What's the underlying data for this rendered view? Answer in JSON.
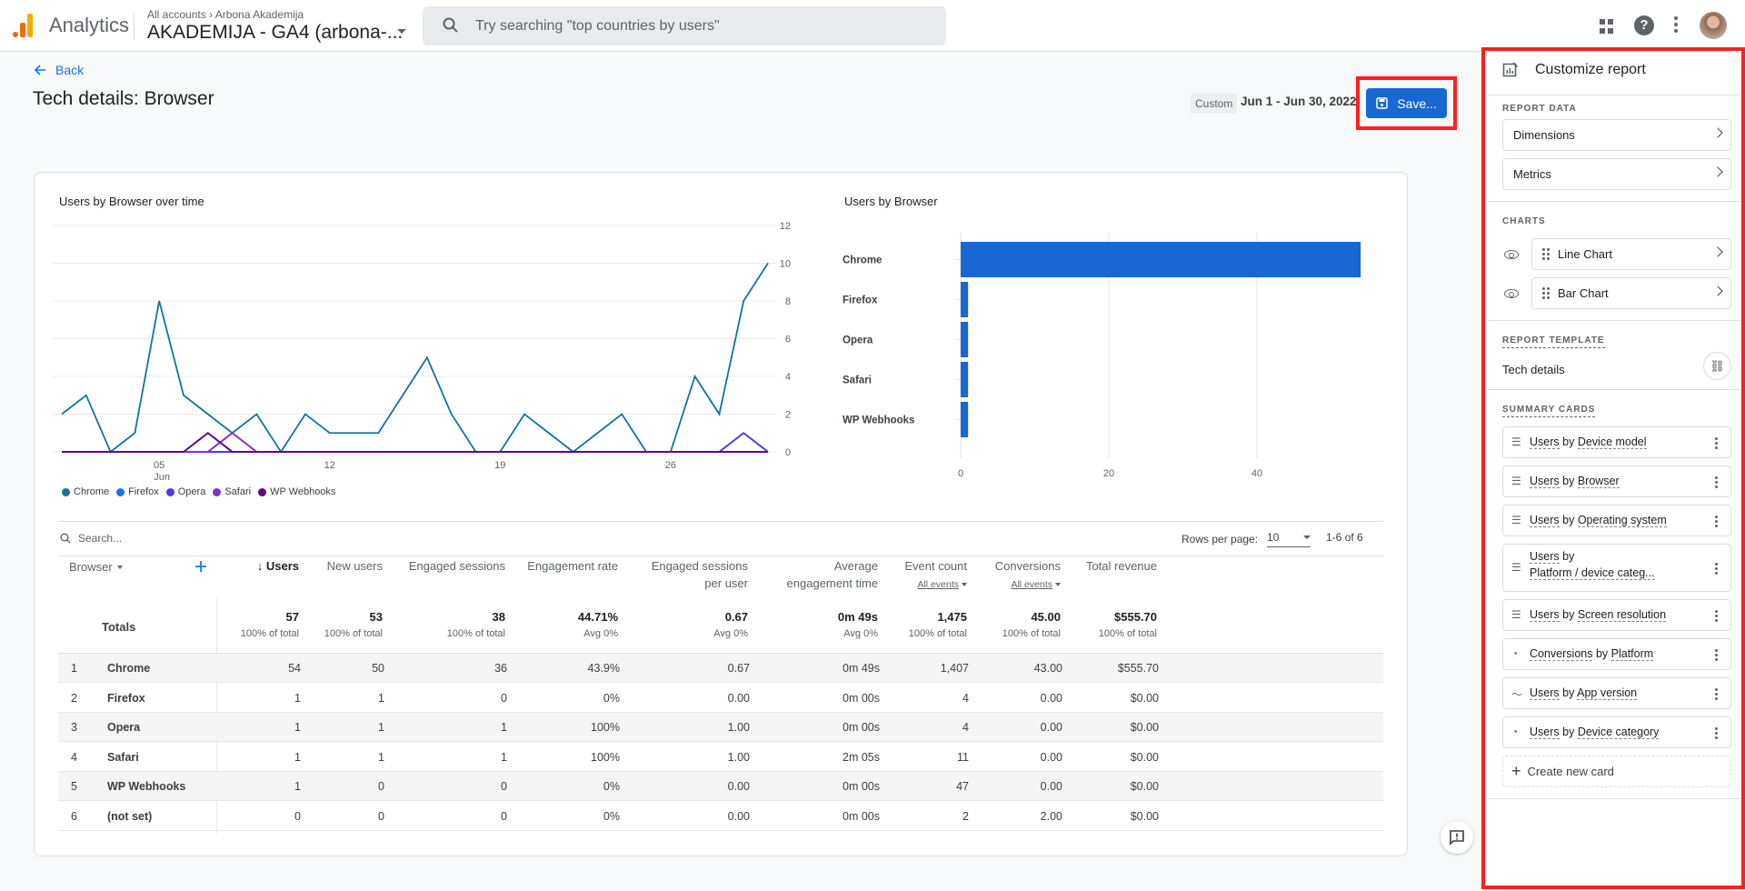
{
  "topbar": {
    "app_name": "Analytics",
    "breadcrumb": "All accounts › Arbona Akademija",
    "property": "AKADEMIJA - GA4 (arbona-...",
    "search_placeholder": "Try searching \"top countries by users\""
  },
  "header": {
    "back_label": "Back",
    "title": "Tech details: Browser",
    "date_chip": "Custom",
    "date_range": "Jun 1 - Jun 30, 2022",
    "save_label": "Save..."
  },
  "colors": {
    "accent": "#1a73e8",
    "save_button": "#1967d2",
    "highlight": "#ff1f1f",
    "bar": "#1967d2"
  },
  "chart_data": [
    {
      "type": "line",
      "title": "Users by Browser over time",
      "x": [
        1,
        2,
        3,
        4,
        5,
        6,
        7,
        8,
        9,
        10,
        11,
        12,
        13,
        14,
        15,
        16,
        17,
        18,
        19,
        20,
        21,
        22,
        23,
        24,
        25,
        26,
        27,
        28,
        29,
        30
      ],
      "x_ticks": [
        {
          "day": 5,
          "label": "05",
          "sublabel": "Jun"
        },
        {
          "day": 12,
          "label": "12",
          "sublabel": ""
        },
        {
          "day": 19,
          "label": "19",
          "sublabel": ""
        },
        {
          "day": 26,
          "label": "26",
          "sublabel": ""
        }
      ],
      "y_ticks": [
        0,
        2,
        4,
        6,
        8,
        10,
        12
      ],
      "ylim": [
        0,
        12
      ],
      "grid": true,
      "legend_position": "bottom-left",
      "series": [
        {
          "name": "Chrome",
          "color": "#12739f",
          "values": [
            2,
            3,
            0,
            1,
            8,
            3,
            2,
            1,
            2,
            0,
            2,
            1,
            1,
            1,
            3,
            5,
            2,
            0,
            0,
            2,
            1,
            0,
            1,
            2,
            0,
            0,
            4,
            2,
            8,
            10
          ]
        },
        {
          "name": "Firefox",
          "color": "#1a73e8",
          "values": [
            0,
            0,
            0,
            0,
            0,
            0,
            0,
            0,
            0,
            0,
            0,
            0,
            0,
            0,
            0,
            0,
            0,
            0,
            0,
            0,
            0,
            0,
            0,
            0,
            0,
            0,
            0,
            0,
            0,
            0
          ]
        },
        {
          "name": "Opera",
          "color": "#4b3ae6",
          "values": [
            0,
            0,
            0,
            0,
            0,
            0,
            0,
            0,
            0,
            0,
            0,
            0,
            0,
            0,
            0,
            0,
            0,
            0,
            0,
            0,
            0,
            0,
            0,
            0,
            0,
            0,
            0,
            0,
            1,
            0
          ]
        },
        {
          "name": "Safari",
          "color": "#7b36c9",
          "values": [
            0,
            0,
            0,
            0,
            0,
            0,
            0,
            1,
            0,
            0,
            0,
            0,
            0,
            0,
            0,
            0,
            0,
            0,
            0,
            0,
            0,
            0,
            0,
            0,
            0,
            0,
            0,
            0,
            0,
            0
          ]
        },
        {
          "name": "WP Webhooks",
          "color": "#5c0a85",
          "values": [
            0,
            0,
            0,
            0,
            0,
            0,
            1,
            0,
            0,
            0,
            0,
            0,
            0,
            0,
            0,
            0,
            0,
            0,
            0,
            0,
            0,
            0,
            0,
            0,
            0,
            0,
            0,
            0,
            0,
            0
          ]
        }
      ]
    },
    {
      "type": "bar",
      "orientation": "horizontal",
      "title": "Users by Browser",
      "categories": [
        "Chrome",
        "Firefox",
        "Opera",
        "Safari",
        "WP Webhooks"
      ],
      "values": [
        54,
        1,
        1,
        1,
        1
      ],
      "x_ticks": [
        0,
        20,
        40,
        60
      ],
      "xlim": [
        0,
        60
      ],
      "grid": true
    }
  ],
  "table": {
    "search_placeholder": "Search...",
    "rows_per_page_label": "Rows per page:",
    "rows_per_page": "10",
    "pager": "1-6 of 6",
    "dimension_header": "Browser",
    "columns": [
      {
        "label": "↓ Users",
        "line2": "",
        "sub": ""
      },
      {
        "label": "New users",
        "line2": "",
        "sub": ""
      },
      {
        "label": "Engaged sessions",
        "line2": "",
        "sub": ""
      },
      {
        "label": "Engagement rate",
        "line2": "",
        "sub": ""
      },
      {
        "label": "Engaged sessions",
        "line2": "per user",
        "sub": ""
      },
      {
        "label": "Average",
        "line2": "engagement time",
        "sub": ""
      },
      {
        "label": "Event count",
        "line2": "",
        "sub": "All events"
      },
      {
        "label": "Conversions",
        "line2": "",
        "sub": "All events"
      },
      {
        "label": "Total revenue",
        "line2": "",
        "sub": ""
      }
    ],
    "totals": {
      "label": "Totals",
      "values": [
        "57",
        "53",
        "38",
        "44.71%",
        "0.67",
        "0m 49s",
        "1,475",
        "45.00",
        "$555.70"
      ],
      "subs": [
        "100% of total",
        "100% of total",
        "100% of total",
        "Avg 0%",
        "Avg 0%",
        "Avg 0%",
        "100% of total",
        "100% of total",
        "100% of total"
      ]
    },
    "rows": [
      {
        "idx": "1",
        "name": "Chrome",
        "values": [
          "54",
          "50",
          "36",
          "43.9%",
          "0.67",
          "0m 49s",
          "1,407",
          "43.00",
          "$555.70"
        ]
      },
      {
        "idx": "2",
        "name": "Firefox",
        "values": [
          "1",
          "1",
          "0",
          "0%",
          "0.00",
          "0m 00s",
          "4",
          "0.00",
          "$0.00"
        ]
      },
      {
        "idx": "3",
        "name": "Opera",
        "values": [
          "1",
          "1",
          "1",
          "100%",
          "1.00",
          "0m 00s",
          "4",
          "0.00",
          "$0.00"
        ]
      },
      {
        "idx": "4",
        "name": "Safari",
        "values": [
          "1",
          "1",
          "1",
          "100%",
          "1.00",
          "2m 05s",
          "11",
          "0.00",
          "$0.00"
        ]
      },
      {
        "idx": "5",
        "name": "WP Webhooks",
        "values": [
          "1",
          "0",
          "0",
          "0%",
          "0.00",
          "0m 00s",
          "47",
          "0.00",
          "$0.00"
        ]
      },
      {
        "idx": "6",
        "name": "(not set)",
        "values": [
          "0",
          "0",
          "0",
          "0%",
          "0.00",
          "0m 00s",
          "2",
          "2.00",
          "$0.00"
        ]
      }
    ]
  },
  "panel": {
    "title": "Customize report",
    "report_data_label": "REPORT DATA",
    "dimensions": "Dimensions",
    "metrics": "Metrics",
    "charts_label": "CHARTS",
    "charts": [
      "Line Chart",
      "Bar Chart"
    ],
    "template_label": "REPORT TEMPLATE",
    "template_name": "Tech details",
    "summary_label": "SUMMARY CARDS",
    "cards": [
      {
        "icon": "bar-table-icon",
        "glyph": "☰",
        "prefix": "Users",
        "mid": " by ",
        "suffix": "Device model",
        "line2": ""
      },
      {
        "icon": "bar-chart-icon",
        "glyph": "☰",
        "prefix": "Users",
        "mid": " by ",
        "suffix": "Browser",
        "line2": ""
      },
      {
        "icon": "bar-table-icon",
        "glyph": "☰",
        "prefix": "Users",
        "mid": " by ",
        "suffix": "Operating system",
        "line2": ""
      },
      {
        "icon": "bar-table-icon",
        "glyph": "☰",
        "prefix": "Users",
        "mid": " by",
        "suffix": "",
        "line2": "Platform / device categ..."
      },
      {
        "icon": "bar-chart-icon",
        "glyph": "☰",
        "prefix": "Users",
        "mid": " by ",
        "suffix": "Screen resolution",
        "line2": ""
      },
      {
        "icon": "donut-chart-icon",
        "glyph": "◔",
        "prefix": "Conversions",
        "mid": " by ",
        "suffix": "Platform",
        "line2": ""
      },
      {
        "icon": "line-chart-icon",
        "glyph": "〜",
        "prefix": "Users",
        "mid": " by ",
        "suffix": "App version",
        "line2": ""
      },
      {
        "icon": "donut-chart-icon",
        "glyph": "◔",
        "prefix": "Users",
        "mid": " by ",
        "suffix": "Device category",
        "line2": ""
      }
    ],
    "create_card": "Create new card"
  }
}
